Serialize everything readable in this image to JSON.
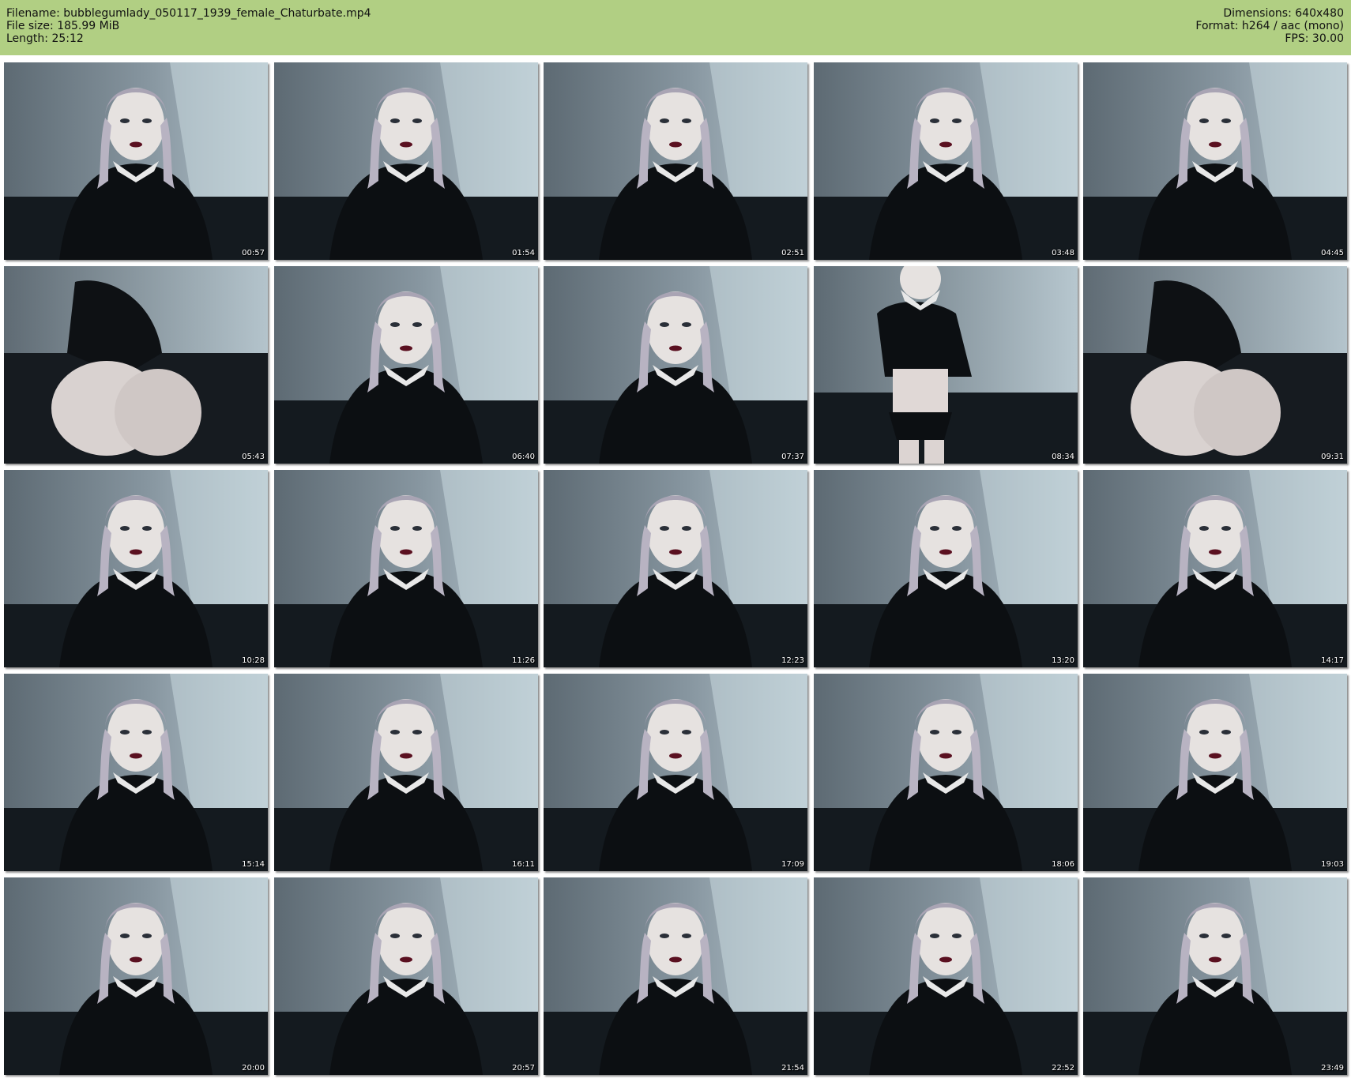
{
  "header": {
    "filename_line": "Filename: bubblegumlady_050117_1939_female_Chaturbate.mp4",
    "filesize_line": "File size: 185.99 MiB",
    "length_line": "Length: 25:12",
    "dimensions_line": "Dimensions: 640x480",
    "format_line": "Format: h264 / aac (mono)",
    "fps_line": "FPS: 30.00",
    "background_color": "#b1cf83"
  },
  "thumbnails": [
    {
      "timestamp": "00:57",
      "scene": "portrait"
    },
    {
      "timestamp": "01:54",
      "scene": "portrait"
    },
    {
      "timestamp": "02:51",
      "scene": "portrait"
    },
    {
      "timestamp": "03:48",
      "scene": "portrait"
    },
    {
      "timestamp": "04:45",
      "scene": "portrait"
    },
    {
      "timestamp": "05:43",
      "scene": "back"
    },
    {
      "timestamp": "06:40",
      "scene": "portrait"
    },
    {
      "timestamp": "07:37",
      "scene": "portrait"
    },
    {
      "timestamp": "08:34",
      "scene": "standing"
    },
    {
      "timestamp": "09:31",
      "scene": "back"
    },
    {
      "timestamp": "10:28",
      "scene": "portrait"
    },
    {
      "timestamp": "11:26",
      "scene": "portrait"
    },
    {
      "timestamp": "12:23",
      "scene": "portrait"
    },
    {
      "timestamp": "13:20",
      "scene": "portrait"
    },
    {
      "timestamp": "14:17",
      "scene": "portrait"
    },
    {
      "timestamp": "15:14",
      "scene": "portrait"
    },
    {
      "timestamp": "16:11",
      "scene": "portrait"
    },
    {
      "timestamp": "17:09",
      "scene": "portrait"
    },
    {
      "timestamp": "18:06",
      "scene": "portrait"
    },
    {
      "timestamp": "19:03",
      "scene": "portrait"
    },
    {
      "timestamp": "20:00",
      "scene": "portrait"
    },
    {
      "timestamp": "20:57",
      "scene": "portrait"
    },
    {
      "timestamp": "21:54",
      "scene": "portrait"
    },
    {
      "timestamp": "22:52",
      "scene": "portrait"
    },
    {
      "timestamp": "23:49",
      "scene": "portrait"
    }
  ]
}
